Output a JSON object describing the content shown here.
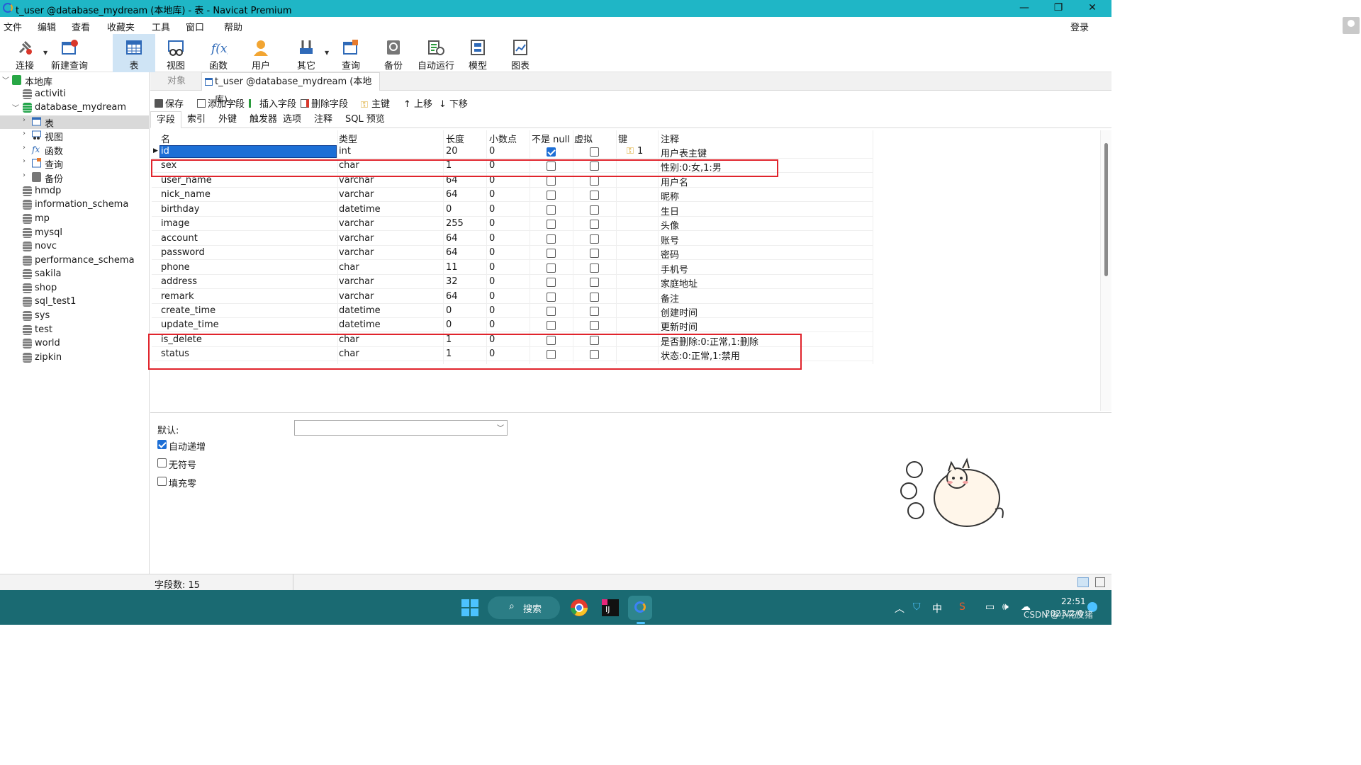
{
  "window": {
    "title": "t_user @database_mydream (本地库) - 表 - Navicat Premium",
    "min": "—",
    "max": "❐",
    "close": "✕"
  },
  "menu": {
    "items": [
      "文件",
      "编辑",
      "查看",
      "收藏夹",
      "工具",
      "窗口",
      "帮助"
    ],
    "login": "登录"
  },
  "toolbar": {
    "items": [
      "连接",
      "新建查询",
      "表",
      "视图",
      "函数",
      "用户",
      "其它",
      "查询",
      "备份",
      "自动运行",
      "模型",
      "图表"
    ]
  },
  "tree": {
    "root": "本地库",
    "databases_top": [
      "activiti"
    ],
    "open_db": "database_mydream",
    "children": [
      "表",
      "视图",
      "函数",
      "查询",
      "备份"
    ],
    "databases_rest": [
      "hmdp",
      "information_schema",
      "mp",
      "mysql",
      "novc",
      "performance_schema",
      "sakila",
      "shop",
      "sql_test1",
      "sys",
      "test",
      "world",
      "zipkin"
    ]
  },
  "tabs": {
    "objects": "对象",
    "active": "t_user @database_mydream (本地库)..."
  },
  "editor_toolbar": {
    "save": "保存",
    "add_field": "添加字段",
    "insert_field": "插入字段",
    "delete_field": "删除字段",
    "primary_key": "主键",
    "move_up": "上移",
    "move_down": "下移"
  },
  "subtabs": [
    "字段",
    "索引",
    "外键",
    "触发器",
    "选项",
    "注释",
    "SQL 预览"
  ],
  "grid": {
    "headers": {
      "name": "名",
      "type": "类型",
      "length": "长度",
      "decimals": "小数点",
      "not_null": "不是 null",
      "virtual": "虚拟",
      "key": "键",
      "comment": "注释"
    },
    "rows": [
      {
        "name": "id",
        "type": "int",
        "length": "20",
        "decimals": "0",
        "not_null": true,
        "virtual": false,
        "key": "1",
        "comment": "用户表主键"
      },
      {
        "name": "sex",
        "type": "char",
        "length": "1",
        "decimals": "0",
        "not_null": false,
        "virtual": false,
        "key": "",
        "comment": "性别:0:女,1:男"
      },
      {
        "name": "user_name",
        "type": "varchar",
        "length": "64",
        "decimals": "0",
        "not_null": false,
        "virtual": false,
        "key": "",
        "comment": "用户名"
      },
      {
        "name": "nick_name",
        "type": "varchar",
        "length": "64",
        "decimals": "0",
        "not_null": false,
        "virtual": false,
        "key": "",
        "comment": "昵称"
      },
      {
        "name": "birthday",
        "type": "datetime",
        "length": "0",
        "decimals": "0",
        "not_null": false,
        "virtual": false,
        "key": "",
        "comment": "生日"
      },
      {
        "name": "image",
        "type": "varchar",
        "length": "255",
        "decimals": "0",
        "not_null": false,
        "virtual": false,
        "key": "",
        "comment": "头像"
      },
      {
        "name": "account",
        "type": "varchar",
        "length": "64",
        "decimals": "0",
        "not_null": false,
        "virtual": false,
        "key": "",
        "comment": "账号"
      },
      {
        "name": "password",
        "type": "varchar",
        "length": "64",
        "decimals": "0",
        "not_null": false,
        "virtual": false,
        "key": "",
        "comment": "密码"
      },
      {
        "name": "phone",
        "type": "char",
        "length": "11",
        "decimals": "0",
        "not_null": false,
        "virtual": false,
        "key": "",
        "comment": "手机号"
      },
      {
        "name": "address",
        "type": "varchar",
        "length": "32",
        "decimals": "0",
        "not_null": false,
        "virtual": false,
        "key": "",
        "comment": "家庭地址"
      },
      {
        "name": "remark",
        "type": "varchar",
        "length": "64",
        "decimals": "0",
        "not_null": false,
        "virtual": false,
        "key": "",
        "comment": "备注"
      },
      {
        "name": "create_time",
        "type": "datetime",
        "length": "0",
        "decimals": "0",
        "not_null": false,
        "virtual": false,
        "key": "",
        "comment": "创建时间"
      },
      {
        "name": "update_time",
        "type": "datetime",
        "length": "0",
        "decimals": "0",
        "not_null": false,
        "virtual": false,
        "key": "",
        "comment": "更新时间"
      },
      {
        "name": "is_delete",
        "type": "char",
        "length": "1",
        "decimals": "0",
        "not_null": false,
        "virtual": false,
        "key": "",
        "comment": "是否删除:0:正常,1:删除"
      },
      {
        "name": "status",
        "type": "char",
        "length": "1",
        "decimals": "0",
        "not_null": false,
        "virtual": false,
        "key": "",
        "comment": "状态:0:正常,1:禁用"
      }
    ]
  },
  "props": {
    "default_label": "默认:",
    "auto_increment": "自动递增",
    "auto_increment_checked": true,
    "unsigned": "无符号",
    "unsigned_checked": false,
    "zerofill": "填充零",
    "zerofill_checked": false
  },
  "status": {
    "field_count": "字段数: 15"
  },
  "taskbar": {
    "search": "搜索",
    "ime": "中",
    "time": "22:51",
    "date": "2023/2/0",
    "watermark": "CSDN @小花皮猪"
  },
  "colors": {
    "accent": "#1fb6c6",
    "selection": "#1d6fd6",
    "highlight_box": "#e0242c",
    "taskbar": "#1a6a72"
  }
}
